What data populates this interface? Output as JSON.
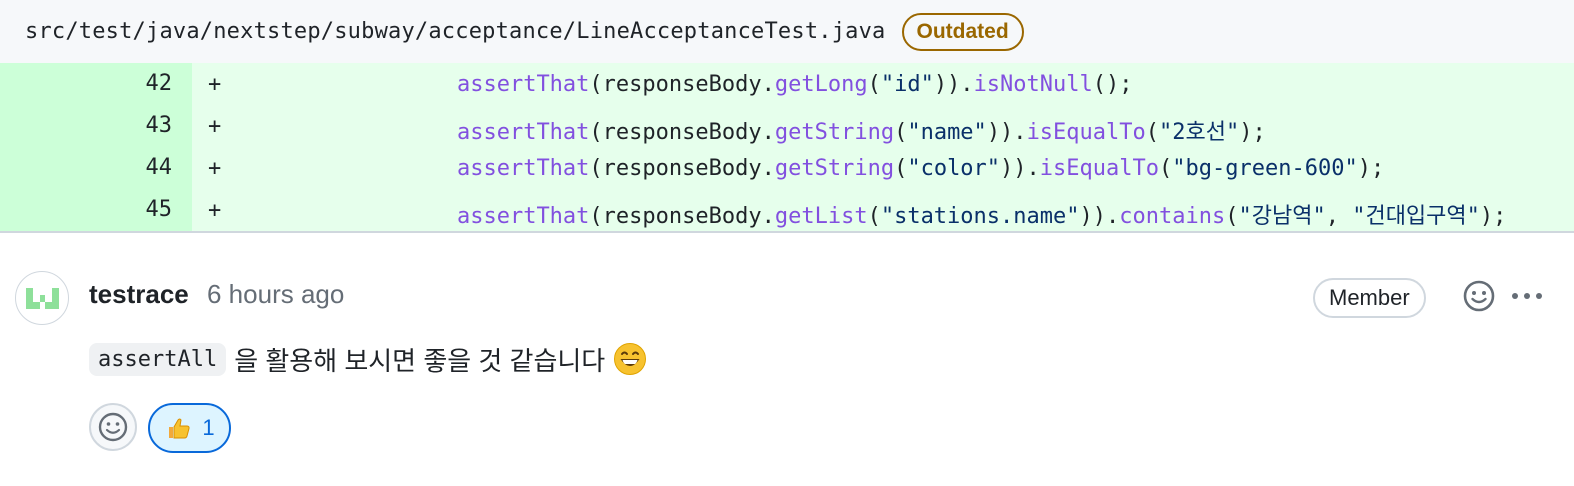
{
  "file_header": {
    "path": "src/test/java/nextstep/subway/acceptance/LineAcceptanceTest.java",
    "badge": "Outdated"
  },
  "diff": {
    "lines": [
      {
        "num": "42",
        "marker": "+",
        "tokens": [
          {
            "t": "        ",
            "k": ""
          },
          {
            "t": "assertThat",
            "k": "m"
          },
          {
            "t": "(responseBody.",
            "k": ""
          },
          {
            "t": "getLong",
            "k": "m"
          },
          {
            "t": "(",
            "k": ""
          },
          {
            "t": "\"id\"",
            "k": "s"
          },
          {
            "t": ")).",
            "k": ""
          },
          {
            "t": "isNotNull",
            "k": "m"
          },
          {
            "t": "();",
            "k": ""
          }
        ]
      },
      {
        "num": "43",
        "marker": "+",
        "tokens": [
          {
            "t": "        ",
            "k": ""
          },
          {
            "t": "assertThat",
            "k": "m"
          },
          {
            "t": "(responseBody.",
            "k": ""
          },
          {
            "t": "getString",
            "k": "m"
          },
          {
            "t": "(",
            "k": ""
          },
          {
            "t": "\"name\"",
            "k": "s"
          },
          {
            "t": ")).",
            "k": ""
          },
          {
            "t": "isEqualTo",
            "k": "m"
          },
          {
            "t": "(",
            "k": ""
          },
          {
            "t": "\"2호선\"",
            "k": "s"
          },
          {
            "t": ");",
            "k": ""
          }
        ]
      },
      {
        "num": "44",
        "marker": "+",
        "tokens": [
          {
            "t": "        ",
            "k": ""
          },
          {
            "t": "assertThat",
            "k": "m"
          },
          {
            "t": "(responseBody.",
            "k": ""
          },
          {
            "t": "getString",
            "k": "m"
          },
          {
            "t": "(",
            "k": ""
          },
          {
            "t": "\"color\"",
            "k": "s"
          },
          {
            "t": ")).",
            "k": ""
          },
          {
            "t": "isEqualTo",
            "k": "m"
          },
          {
            "t": "(",
            "k": ""
          },
          {
            "t": "\"bg-green-600\"",
            "k": "s"
          },
          {
            "t": ");",
            "k": ""
          }
        ]
      },
      {
        "num": "45",
        "marker": "+",
        "tokens": [
          {
            "t": "        ",
            "k": ""
          },
          {
            "t": "assertThat",
            "k": "m"
          },
          {
            "t": "(responseBody.",
            "k": ""
          },
          {
            "t": "getList",
            "k": "m"
          },
          {
            "t": "(",
            "k": ""
          },
          {
            "t": "\"stations.name\"",
            "k": "s"
          },
          {
            "t": ")).",
            "k": ""
          },
          {
            "t": "contains",
            "k": "m"
          },
          {
            "t": "(",
            "k": ""
          },
          {
            "t": "\"강남역\"",
            "k": "s"
          },
          {
            "t": ", ",
            "k": ""
          },
          {
            "t": "\"건대입구역\"",
            "k": "s"
          },
          {
            "t": ");",
            "k": ""
          }
        ]
      }
    ]
  },
  "comment": {
    "author": "testrace",
    "time": "6 hours ago",
    "role_badge": "Member",
    "code_chip": "assertAll",
    "text": "을 활용해 보시면 좋을 것 같습니다",
    "emoji_icon": "grinning-face-icon",
    "reactions": [
      {
        "icon": "thumbs-up-icon",
        "count": "1"
      }
    ]
  },
  "colors": {
    "added_line_bg": "#e6ffec",
    "added_num_bg": "#ccffd8",
    "method": "#8250df",
    "string": "#0a3069",
    "outdated": "#9a6700",
    "reaction_accent": "#0969da"
  }
}
